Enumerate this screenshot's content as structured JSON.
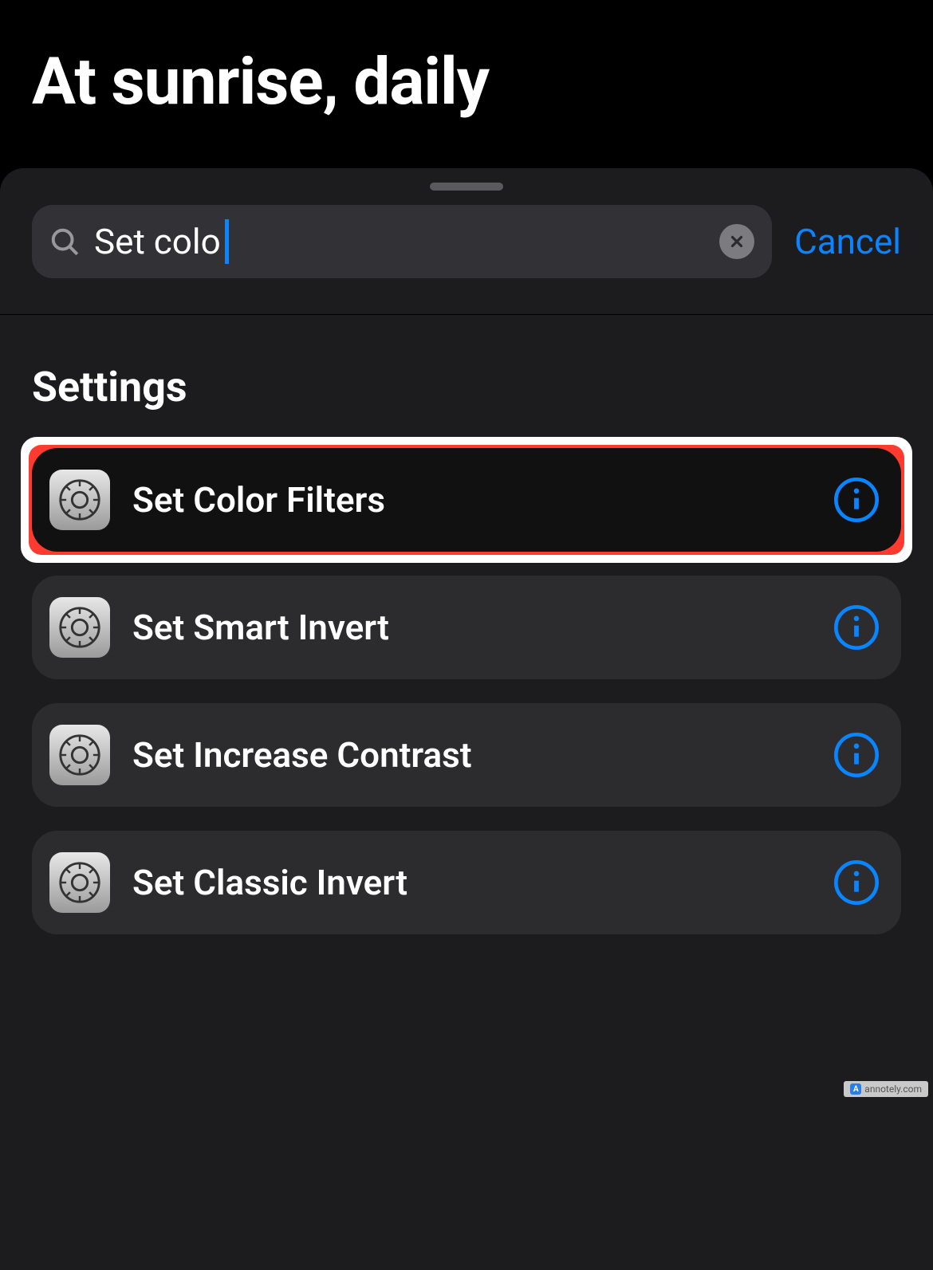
{
  "header": {
    "title": "At sunrise, daily"
  },
  "search": {
    "value": "Set colo",
    "cancel_label": "Cancel"
  },
  "results": {
    "section_title": "Settings",
    "items": [
      {
        "label": "Set Color Filters",
        "highlighted": true
      },
      {
        "label": "Set Smart Invert",
        "highlighted": false
      },
      {
        "label": "Set Increase Contrast",
        "highlighted": false
      },
      {
        "label": "Set Classic Invert",
        "highlighted": false
      }
    ]
  },
  "watermark": {
    "text": "annotely.com"
  }
}
